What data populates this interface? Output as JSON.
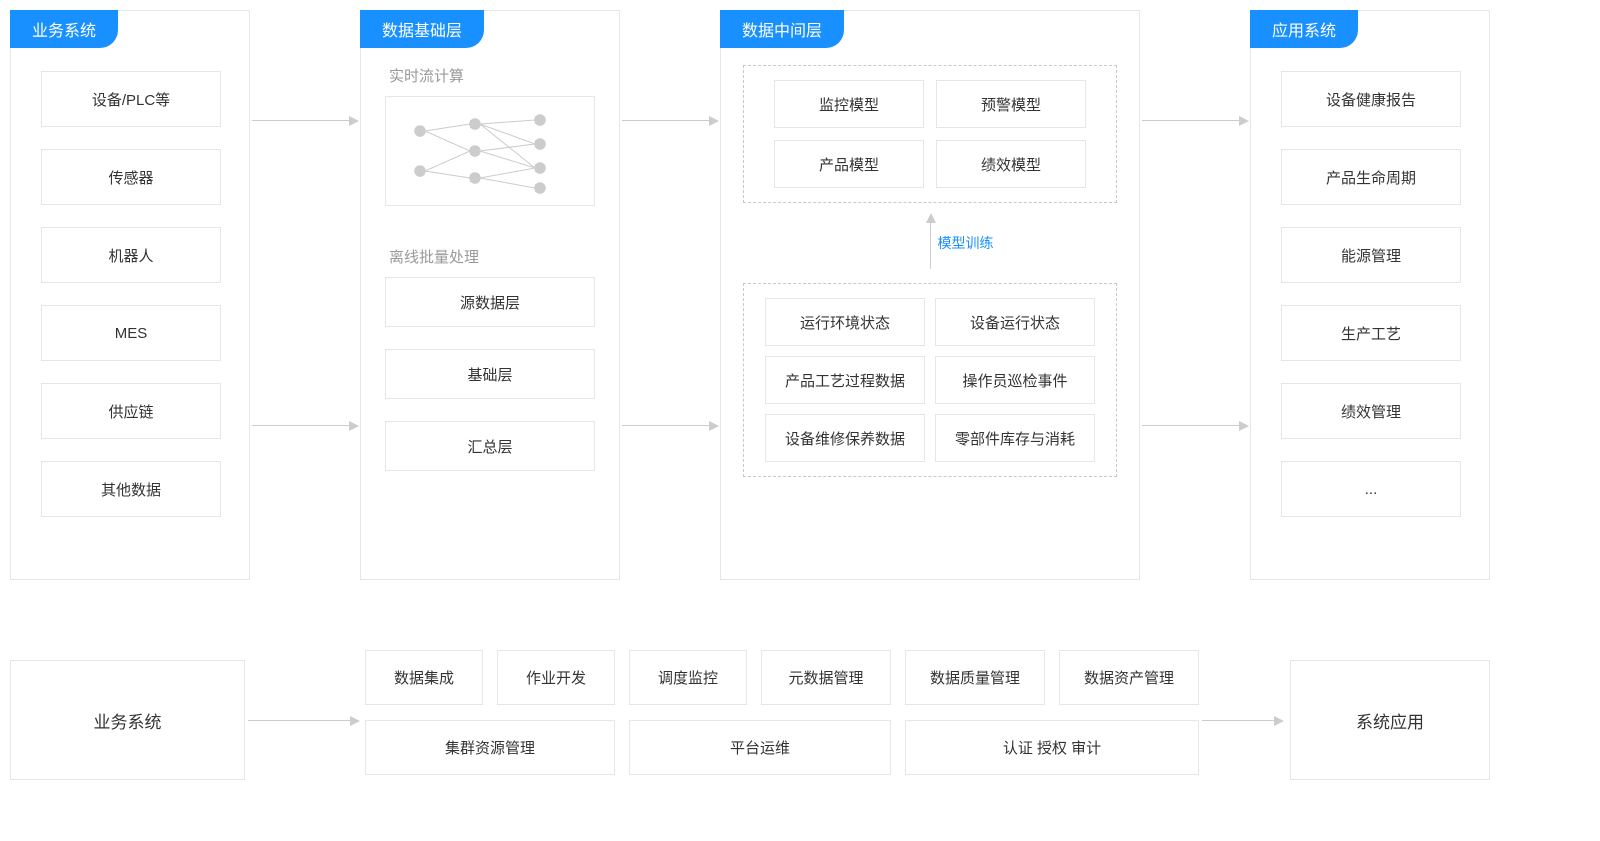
{
  "columns": {
    "business": {
      "title": "业务系统",
      "items": [
        "设备/PLC等",
        "传感器",
        "机器人",
        "MES",
        "供应链",
        "其他数据"
      ]
    },
    "foundation": {
      "title": "数据基础层",
      "stream_label": "实时流计算",
      "batch_label": "离线批量处理",
      "batch_items": [
        "源数据层",
        "基础层",
        "汇总层"
      ]
    },
    "middle": {
      "title": "数据中间层",
      "models": [
        "监控模型",
        "预警模型",
        "产品模型",
        "绩效模型"
      ],
      "training_label": "模型训练",
      "data_items": [
        "运行环境状态",
        "设备运行状态",
        "产品工艺过程数据",
        "操作员巡检事件",
        "设备维修保养数据",
        "零部件库存与消耗"
      ]
    },
    "app": {
      "title": "应用系统",
      "items": [
        "设备健康报告",
        "产品生命周期",
        "能源管理",
        "生产工艺",
        "绩效管理",
        "..."
      ]
    }
  },
  "bottom": {
    "left": "业务系统",
    "row1": [
      "数据集成",
      "作业开发",
      "调度监控",
      "元数据管理",
      "数据质量管理",
      "数据资产管理"
    ],
    "row2": [
      "集群资源管理",
      "平台运维",
      "认证  授权  审计"
    ],
    "right": "系统应用"
  },
  "colors": {
    "accent": "#1890ff"
  }
}
